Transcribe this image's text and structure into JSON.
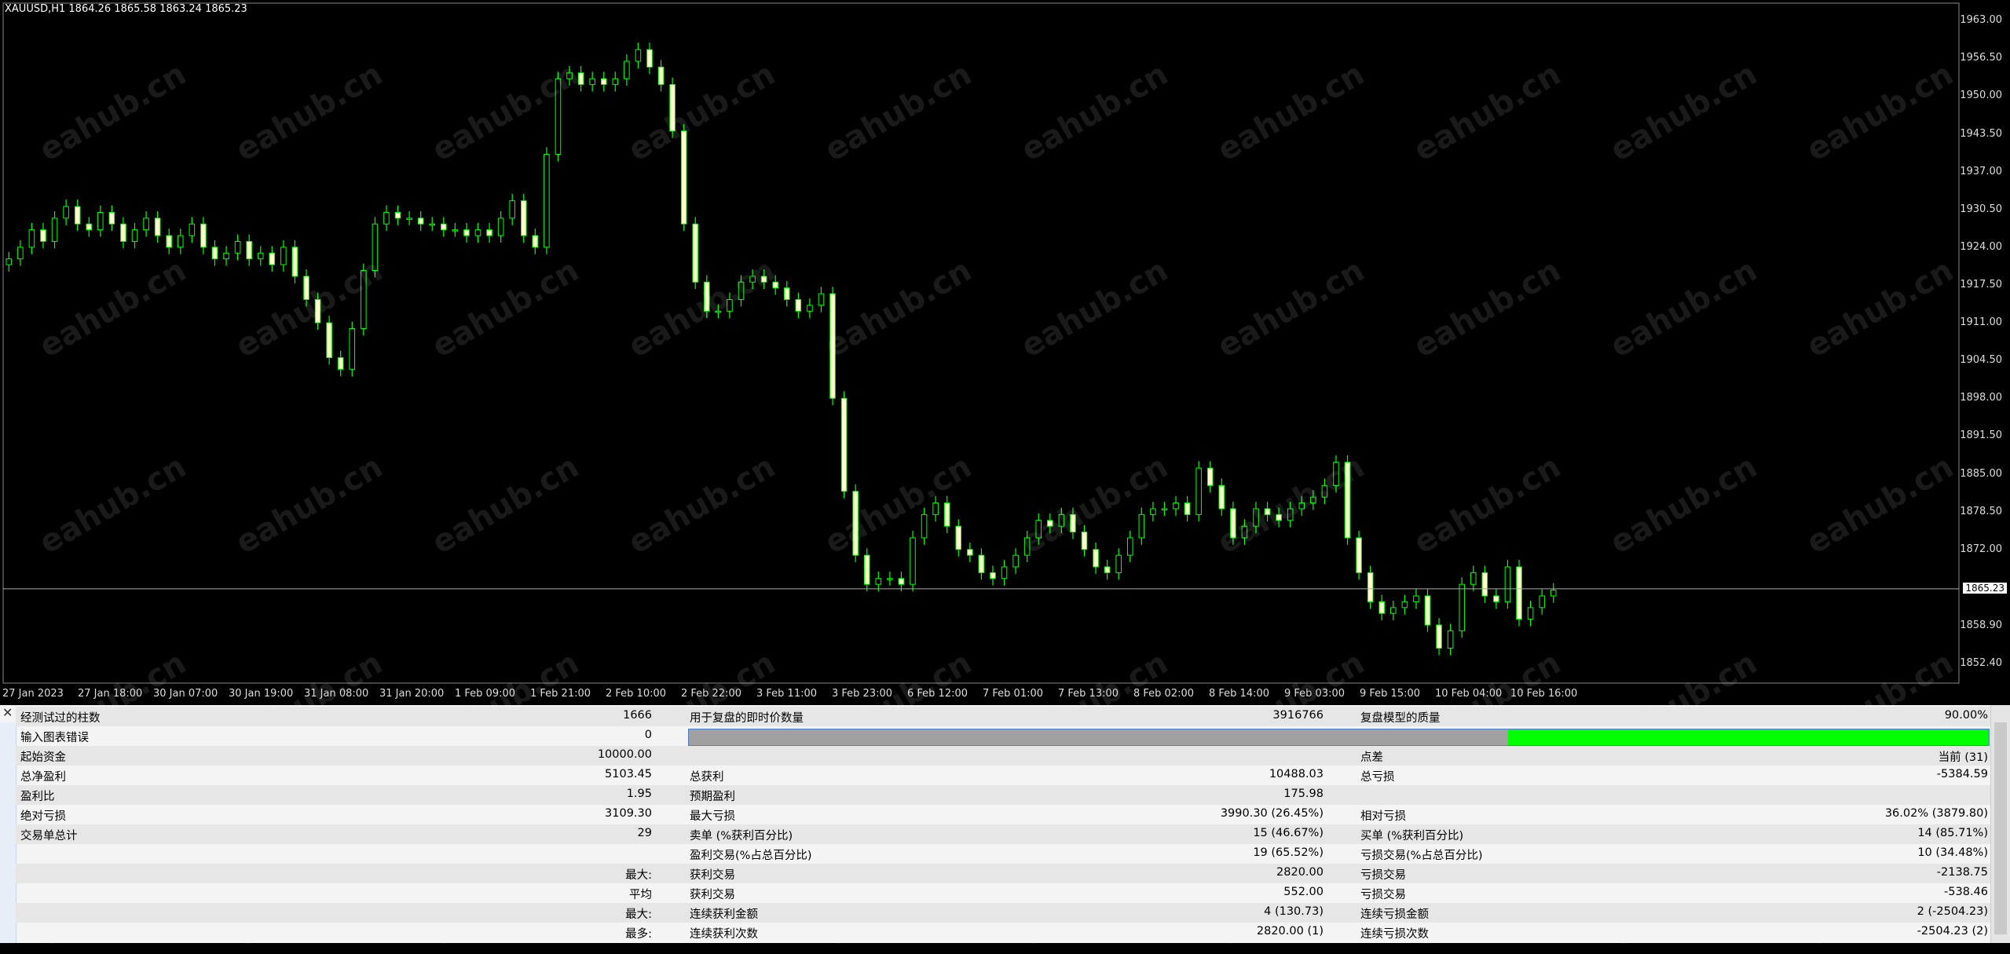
{
  "chart": {
    "symbol_info": "XAUUSD,H1  1864.26 1865.58 1863.24 1865.23",
    "price_labels": [
      "1963.00",
      "1956.50",
      "1950.00",
      "1943.50",
      "1937.00",
      "1930.50",
      "1924.00",
      "1917.50",
      "1911.00",
      "1904.50",
      "1898.00",
      "1891.50",
      "1885.00",
      "1878.50",
      "1872.00",
      "1858.90",
      "1852.40"
    ],
    "current_price": "1865.23",
    "time_labels": [
      "27 Jan 2023",
      "27 Jan 18:00",
      "30 Jan 07:00",
      "30 Jan 19:00",
      "31 Jan 08:00",
      "31 Jan 20:00",
      "1 Feb 09:00",
      "1 Feb 21:00",
      "2 Feb 10:00",
      "2 Feb 22:00",
      "3 Feb 11:00",
      "3 Feb 23:00",
      "6 Feb 12:00",
      "7 Feb 01:00",
      "7 Feb 13:00",
      "8 Feb 02:00",
      "8 Feb 14:00",
      "9 Feb 03:00",
      "9 Feb 15:00",
      "10 Feb 04:00",
      "10 Feb 16:00"
    ],
    "watermark": "eahub.cn",
    "colors": {
      "bull": "#00ff00",
      "bear": "#ffffcc",
      "background": "#000000"
    }
  },
  "chart_data": {
    "type": "candlestick",
    "symbol": "XAUUSD",
    "timeframe": "H1",
    "ylim": [
      1849,
      1966
    ],
    "closes": [
      1922,
      1924,
      1927,
      1925,
      1929,
      1931,
      1928,
      1927,
      1930,
      1928,
      1925,
      1927,
      1929,
      1926,
      1924,
      1926,
      1928,
      1924,
      1922,
      1923,
      1925,
      1922,
      1923,
      1921,
      1924,
      1919,
      1915,
      1911,
      1905,
      1903,
      1910,
      1920,
      1928,
      1930,
      1929,
      1929,
      1928,
      1928,
      1927,
      1927,
      1926,
      1927,
      1926,
      1929,
      1932,
      1926,
      1924,
      1940,
      1953,
      1954,
      1952,
      1953,
      1952,
      1953,
      1956,
      1958,
      1955,
      1952,
      1944,
      1928,
      1918,
      1913,
      1913,
      1915,
      1918,
      1919,
      1918,
      1917,
      1915,
      1913,
      1914,
      1916,
      1898,
      1882,
      1871,
      1866,
      1867,
      1867,
      1866,
      1874,
      1878,
      1880,
      1876,
      1872,
      1871,
      1868,
      1867,
      1869,
      1871,
      1874,
      1877,
      1876,
      1878,
      1875,
      1872,
      1869,
      1868,
      1871,
      1874,
      1878,
      1879,
      1879,
      1880,
      1878,
      1886,
      1883,
      1879,
      1874,
      1876,
      1879,
      1878,
      1877,
      1879,
      1880,
      1881,
      1883,
      1887,
      1874,
      1868,
      1863,
      1861,
      1862,
      1863,
      1864,
      1859,
      1855,
      1858,
      1866,
      1868,
      1864,
      1863,
      1869,
      1860,
      1862,
      1864,
      1865
    ],
    "stats_ref": "see report"
  },
  "report": {
    "close_icon": "close-icon",
    "rows": [
      {
        "c1_label": "经测试过的柱数",
        "c1_value": "1666",
        "c2_label": "用于复盘的即时价数量",
        "c2_value": "3916766",
        "c3_label": "复盘模型的质量",
        "c3_value": "90.00%"
      },
      {
        "c1_label": "输入图表错误",
        "c1_value": "0",
        "c2_label": "",
        "c2_value": "",
        "c3_label": "",
        "c3_value": ""
      },
      {
        "c1_label": "起始资金",
        "c1_value": "10000.00",
        "c2_label": "",
        "c2_value": "",
        "c3_label": "点差",
        "c3_value": "当前 (31)"
      },
      {
        "c1_label": "总净盈利",
        "c1_value": "5103.45",
        "c2_label": "总获利",
        "c2_value": "10488.03",
        "c3_label": "总亏损",
        "c3_value": "-5384.59"
      },
      {
        "c1_label": "盈利比",
        "c1_value": "1.95",
        "c2_label": "预期盈利",
        "c2_value": "175.98",
        "c3_label": "",
        "c3_value": ""
      },
      {
        "c1_label": "绝对亏损",
        "c1_value": "3109.30",
        "c2_label": "最大亏损",
        "c2_value": "3990.30 (26.45%)",
        "c3_label": "相对亏损",
        "c3_value": "36.02% (3879.80)"
      },
      {
        "c1_label": "交易单总计",
        "c1_value": "29",
        "c2_label": "卖单 (%获利百分比)",
        "c2_value": "15 (46.67%)",
        "c3_label": "买单 (%获利百分比)",
        "c3_value": "14 (85.71%)"
      },
      {
        "c1_label": "",
        "c1_value": "",
        "c2_label": "盈利交易(%占总百分比)",
        "c2_value": "19 (65.52%)",
        "c3_label": "亏损交易(%占总百分比)",
        "c3_value": "10 (34.48%)"
      },
      {
        "c1_label": "",
        "c1_value": "最大:",
        "c2_label": "获利交易",
        "c2_value": "2820.00",
        "c3_label": "亏损交易",
        "c3_value": "-2138.75"
      },
      {
        "c1_label": "",
        "c1_value": "平均",
        "c2_label": "获利交易",
        "c2_value": "552.00",
        "c3_label": "亏损交易",
        "c3_value": "-538.46"
      },
      {
        "c1_label": "",
        "c1_value": "最大:",
        "c2_label": "连续获利金额",
        "c2_value": "4 (130.73)",
        "c3_label": "连续亏损金额",
        "c3_value": "2 (-2504.23)"
      },
      {
        "c1_label": "",
        "c1_value": "最多:",
        "c2_label": "连续获利次数",
        "c2_value": "2820.00 (1)",
        "c3_label": "连续亏损次数",
        "c3_value": "-2504.23 (2)"
      }
    ],
    "quality_progress": 0.37
  }
}
